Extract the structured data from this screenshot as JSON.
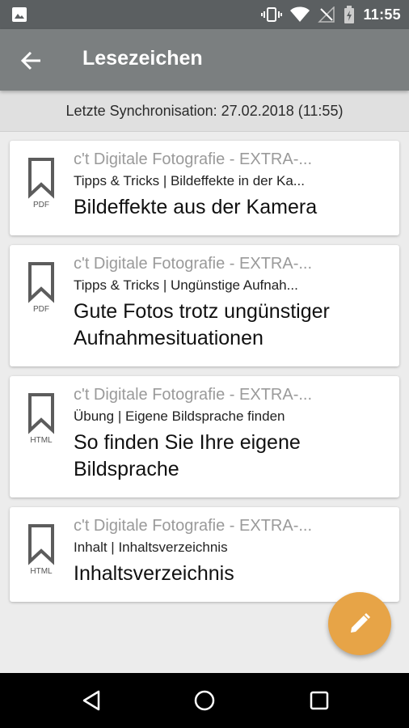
{
  "status_bar": {
    "time": "11:55",
    "icons": [
      "gallery-icon",
      "vibrate-icon",
      "wifi-icon",
      "no-signal-icon",
      "battery-charging-icon"
    ]
  },
  "app_bar": {
    "title": "Lesezeichen",
    "back_icon": "arrow-back-icon"
  },
  "sync": {
    "text": "Letzte Synchronisation: 27.02.2018 (11:55)"
  },
  "bookmarks": [
    {
      "type": "PDF",
      "series": "c't Digitale Fotografie - EXTRA-...",
      "subtitle": "Tipps & Tricks | Bildeffekte in der Ka...",
      "headline": "Bildeffekte aus der Kamera"
    },
    {
      "type": "PDF",
      "series": "c't Digitale Fotografie - EXTRA-...",
      "subtitle": "Tipps & Tricks | Ungünstige Aufnah...",
      "headline": "Gute Fotos trotz ungünstiger Aufnahmesituationen"
    },
    {
      "type": "HTML",
      "series": "c't Digitale Fotografie - EXTRA-...",
      "subtitle": "Übung | Eigene Bildsprache finden",
      "headline": "So finden Sie Ihre eigene Bildsprache"
    },
    {
      "type": "HTML",
      "series": "c't Digitale Fotografie - EXTRA-...",
      "subtitle": "Inhalt | Inhaltsverzeichnis",
      "headline": "Inhaltsverzeichnis"
    }
  ],
  "fab": {
    "icon": "edit-pencil-icon",
    "color": "#e7a447"
  },
  "colors": {
    "status_bar": "#5b5f61",
    "app_bar": "#7b7f80",
    "background": "#ececec"
  },
  "nav_bar": {
    "icons": [
      "nav-back-icon",
      "nav-home-icon",
      "nav-recents-icon"
    ]
  }
}
